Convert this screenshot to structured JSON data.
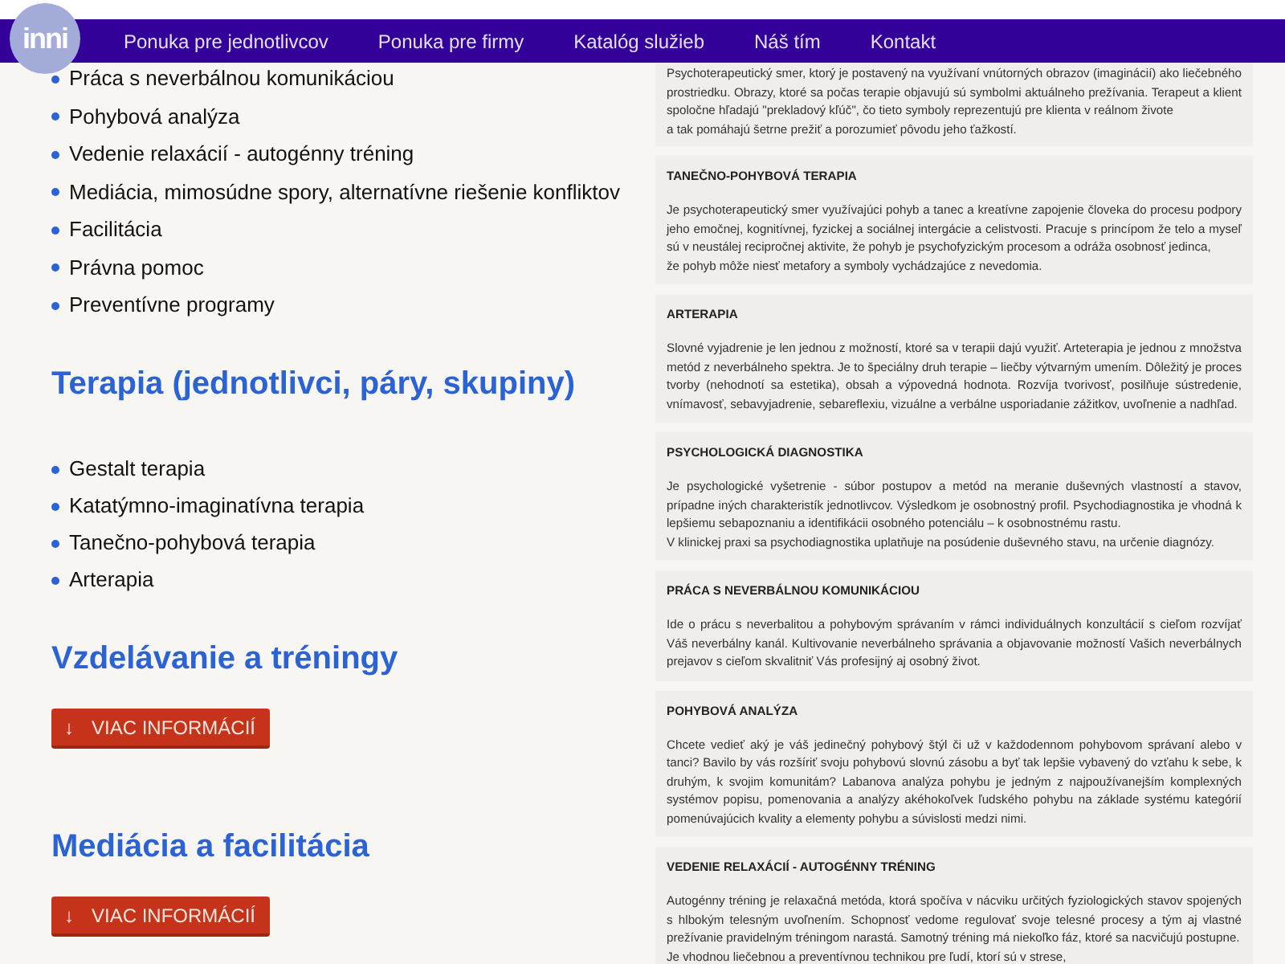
{
  "logo": "inni",
  "nav": [
    "Ponuka pre jednotlivcov",
    "Ponuka pre firmy",
    "Katalóg služieb",
    "Náš tím",
    "Kontakt"
  ],
  "left": [
    {
      "kind": "list",
      "items": [
        "Práca s neverbálnou komunikáciou",
        "Pohybová analýza",
        "Vedenie relaxácií - autogénny tréning",
        "Mediácia, mimosúdne spory, alternatívne riešenie konfliktov",
        "Facilitácia",
        "Právna pomoc",
        "Preventívne programy"
      ]
    },
    {
      "kind": "heading",
      "text": "Terapia (jednotlivci, páry, skupiny)"
    },
    {
      "kind": "list",
      "items": [
        "Gestalt terapia",
        "Katatýmno-imaginatívna terapia",
        "Tanečno-pohybová terapia",
        "Arterapia"
      ]
    },
    {
      "kind": "heading",
      "text": "Vzdelávanie a tréningy"
    },
    {
      "kind": "button",
      "icon": "↓",
      "label": "VIAC INFORMÁCIÍ"
    },
    {
      "kind": "heading",
      "text": "Mediácia a facilitácia"
    },
    {
      "kind": "button",
      "icon": "↓",
      "label": "VIAC INFORMÁCIÍ"
    }
  ],
  "panels": [
    {
      "text": "Psychoterapeutický smer, ktorý je postavený na využívaní vnútorných obrazov (imaginácií) ako liečebného prostriedku. Obrazy, ktoré sa počas terapie objavujú sú symbolmi aktuálneho prežívania. Terapeut a klient spoločne hľadajú \"prekladový kľúč\", čo tieto symboly reprezentujú pre klienta v reálnom živote\na tak pomáhajú šetrne prežiť a porozumieť pôvodu jeho ťažkostí."
    },
    {
      "heading": "TANEČNO-POHYBOVÁ TERAPIA",
      "text": "Je psychoterapeutický smer využívajúci pohyb a tanec a kreatívne zapojenie človeka do procesu podpory jeho emočnej, kognitívnej, fyzickej a sociálnej intergácie a celistvosti. Pracuje s princípom že telo a myseľ sú v neustálej recipročnej aktivite, že pohyb je psychofyzickým procesom a odráža osobnosť jedinca,\nže pohyb môže niesť metafory a symboly vychádzajúce z nevedomia."
    },
    {
      "heading": "ARTERAPIA",
      "text": "Slovné vyjadrenie je len jednou z možností, ktoré sa v terapii dajú využiť. Arteterapia je jednou z množstva metód z neverbálneho spektra. Je to špeciálny druh terapie – liečby výtvarným umením. Dôležitý je proces tvorby (nehodnotí sa estetika), obsah a výpovedná hodnota. Rozvíja tvorivosť, posilňuje sústredenie, vnímavosť, sebavyjadrenie, sebareflexiu, vizuálne a verbálne usporiadanie zážitkov, uvoľnenie a nadhľad."
    },
    {
      "heading": "PSYCHOLOGICKÁ DIAGNOSTIKA",
      "text": "Je psychologické vyšetrenie - súbor postupov a metód na meranie duševných vlastností a stavov, prípadne iných charakteristík jednotlivcov. Výsledkom je osobnostný profil. Psychodiagnostika je vhodná k lepšiemu sebapoznaniu a identifikácii osobného potenciálu – k osobnostnému rastu.\nV klinickej praxi sa psychodiagnostika uplatňuje na posúdenie duševného stavu, na určenie diagnózy."
    },
    {
      "heading": "PRÁCA S NEVERBÁLNOU KOMUNIKÁCIOU",
      "text": "Ide o prácu s neverbalitou a pohybovým správaním v rámci individuálnych konzultácií s cieľom rozvíjať Váš neverbálny kanál. Kultivovanie neverbálneho správania a objavovanie možností Vašich neverbálnych prejavov s cieľom skvalitniť Vás profesijný aj osobný život."
    },
    {
      "heading": "POHYBOVÁ ANALÝZA",
      "text": "Chcete vedieť aký je váš jedinečný pohybový štýl či už v každodennom pohybovom správaní alebo v tanci? Bavilo by vás rozšíriť svoju pohybovú slovnú zásobu a byť tak lepšie vybavený do vzťahu k sebe, k druhým, k svojim komunitám? Labanova analýza pohybu je jedným z najpoužívanejším komplexných systémov popisu, pomenovania a analýzy akéhokoľvek ľudského pohybu na základe systému kategórií pomenúvajúcich kvality a elementy pohybu a súvislosti medzi nimi."
    },
    {
      "heading": "VEDENIE RELAXÁCIÍ - AUTOGÉNNY TRÉNING",
      "text": "Autogénny tréning je relaxačná metóda, ktorá spočíva v nácviku určitých fyziologických stavov spojených s hlbokým telesným uvoľnením. Schopnosť vedome regulovať svoje telesné procesy a tým aj vlastné prežívanie pravidelným tréningom narastá. Samotný tréning má niekoľko fáz, ktoré sa nacvičujú postupne.\nJe vhodnou liečebnou a preventívnou technikou pre ľudí, ktorí sú v strese,"
    }
  ]
}
